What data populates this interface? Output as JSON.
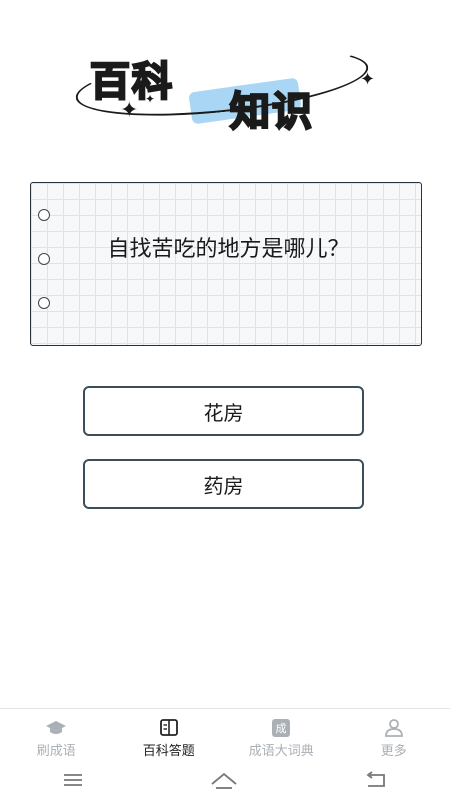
{
  "logo": {
    "line1": "百科",
    "line2": "知识"
  },
  "question": "自找苦吃的地方是哪儿？",
  "answers": [
    {
      "label": "花房"
    },
    {
      "label": "药房"
    }
  ],
  "tabs": [
    {
      "label": "刷成语",
      "icon": "graduation-cap-icon",
      "active": false
    },
    {
      "label": "百科答题",
      "icon": "book-icon",
      "active": true
    },
    {
      "label": "成语大词典",
      "icon": "dictionary-icon",
      "active": false
    },
    {
      "label": "更多",
      "icon": "user-icon",
      "active": false
    }
  ],
  "dict_badge": "成",
  "system_nav": [
    "menu-icon",
    "home-icon",
    "back-icon"
  ]
}
